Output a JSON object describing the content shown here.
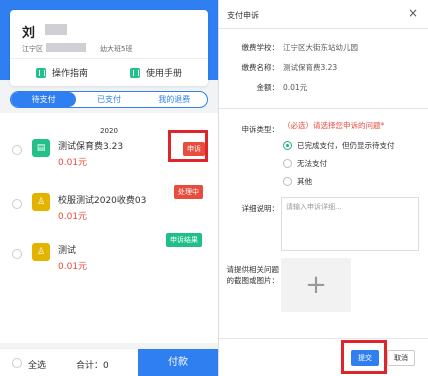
{
  "left": {
    "user_name": "刘",
    "school_prefix": "江宁区",
    "class": "幼大班5班",
    "quick": [
      {
        "label": "操作指南"
      },
      {
        "label": "使用手册"
      }
    ],
    "tabs": [
      {
        "label": "待支付"
      },
      {
        "label": "已支付"
      },
      {
        "label": "我的退费"
      }
    ],
    "year": "2020",
    "items": [
      {
        "name": "测试保育费3.23",
        "amount": "0.01元",
        "badge": "申诉",
        "badge_color": "#e74c3c",
        "icon_color": "#23c08a"
      },
      {
        "name": "校服测试2020收费03",
        "amount": "0.01元",
        "badge": "处理中",
        "badge_color": "#e74c3c",
        "icon_color": "#e2b400"
      },
      {
        "name": "测试",
        "amount": "0.01元",
        "badge": "申诉结果",
        "badge_color": "#1fbf8a",
        "icon_color": "#e2b400"
      }
    ],
    "footer": {
      "select_all": "全选",
      "total": "合计：0",
      "pay": "付款"
    }
  },
  "right": {
    "title": "支付申诉",
    "close": "×",
    "school_label": "缴费学校：",
    "school_value": "江宁区大街东站幼儿园",
    "fee_label": "缴费名称：",
    "fee_value": "测试保育费3.23",
    "amount_label": "金额：",
    "amount_value": "0.01元",
    "type_label": "申诉类型：",
    "type_hint": "（必选）请选择您申诉的问题*",
    "options": [
      {
        "label": "已完成支付，但仍显示待支付"
      },
      {
        "label": "无法支付"
      },
      {
        "label": "其他"
      }
    ],
    "detail_label": "详细说明：",
    "detail_placeholder": "请输入申诉详细...",
    "image_label": "请提供相关问题的截图或图片：",
    "submit": "提交",
    "cancel": "取消"
  }
}
